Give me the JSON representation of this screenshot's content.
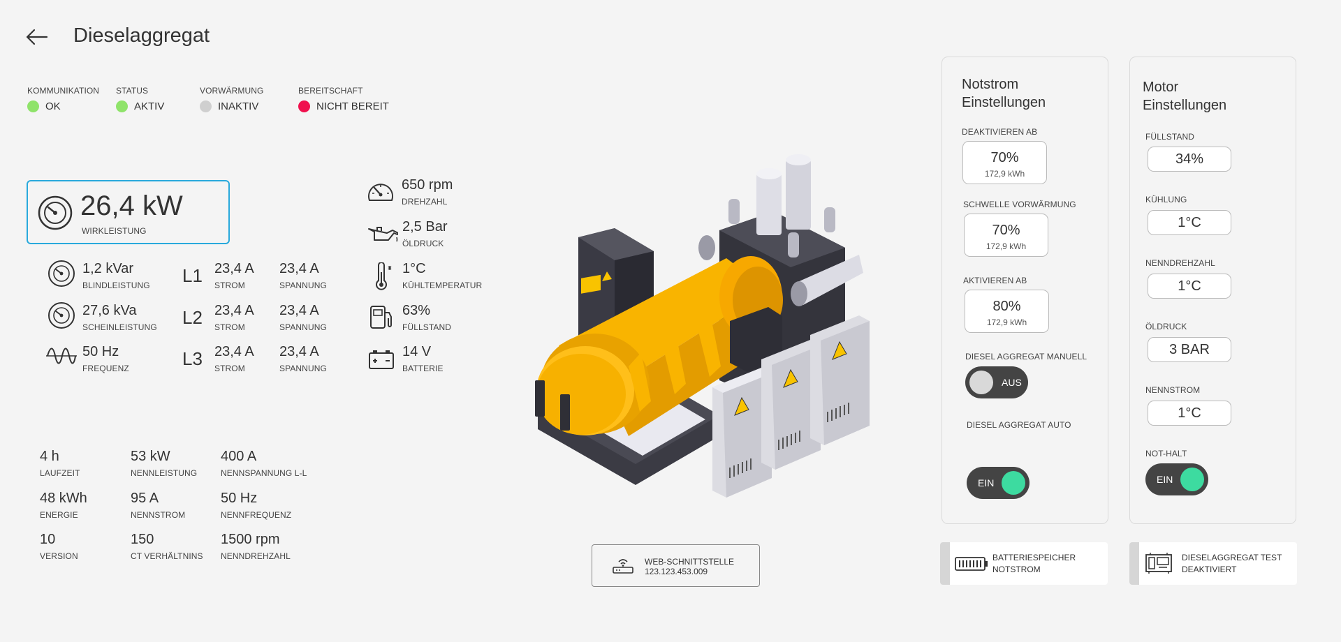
{
  "header": {
    "title": "Dieselaggregat"
  },
  "status": [
    {
      "label": "KOMMUNIKATION",
      "value": "OK",
      "color": "#8fe36a"
    },
    {
      "label": "STATUS",
      "value": "AKTIV",
      "color": "#8fe36a"
    },
    {
      "label": "VORWÄRMUNG",
      "value": "INAKTIV",
      "color": "#cfcfcf"
    },
    {
      "label": "BEREITSCHAFT",
      "value": "NICHT BEREIT",
      "color": "#f0114e"
    }
  ],
  "main_power": {
    "value": "26,4 kW",
    "label": "WIRKLEISTUNG",
    "icon": "gauge-icon",
    "accent": "#29a9dc"
  },
  "power_list": [
    {
      "value": "1,2 kVar",
      "label": "BLINDLEISTUNG"
    },
    {
      "value": "27,6 kVa",
      "label": "SCHEINLEISTUNG"
    },
    {
      "value": "50 Hz",
      "label": "FREQUENZ"
    }
  ],
  "phases": [
    {
      "name": "L1",
      "strom": "23,4 A",
      "strom_label": "STROM",
      "spannung": "23,4 A",
      "spannung_label": "SPANNUNG"
    },
    {
      "name": "L2",
      "strom": "23,4 A",
      "strom_label": "STROM",
      "spannung": "23,4 A",
      "spannung_label": "SPANNUNG"
    },
    {
      "name": "L3",
      "strom": "23,4 A",
      "strom_label": "STROM",
      "spannung": "23,4 A",
      "spannung_label": "SPANNUNG"
    }
  ],
  "engine_stats": [
    {
      "value": "650 rpm",
      "label": "DREHZAHL",
      "icon": "speedometer-icon"
    },
    {
      "value": "2,5 Bar",
      "label": "ÖLDRUCK",
      "icon": "oil-can-icon"
    },
    {
      "value": "1°C",
      "label": "KÜHLTEMPERATUR",
      "icon": "thermometer-icon"
    },
    {
      "value": "63%",
      "label": "FÜLLSTAND",
      "icon": "fuel-pump-icon"
    },
    {
      "value": "14 V",
      "label": "BATTERIE",
      "icon": "battery-icon"
    }
  ],
  "specs": [
    {
      "value": "4 h",
      "label": "LAUFZEIT"
    },
    {
      "value": "53 kW",
      "label": "NENNLEISTUNG"
    },
    {
      "value": "400 A",
      "label": "NENNSPANNUNG L-L"
    },
    {
      "value": "48 kWh",
      "label": "ENERGIE"
    },
    {
      "value": "95 A",
      "label": "NENNSTROM"
    },
    {
      "value": "50 Hz",
      "label": "NENNFREQUENZ"
    },
    {
      "value": "10",
      "label": "VERSION"
    },
    {
      "value": "150",
      "label": "CT VERHÄLTNINS"
    },
    {
      "value": "1500 rpm",
      "label": "NENNDREHZAHL"
    }
  ],
  "web_interface": {
    "label": "WEB-SCHNITTSTELLE",
    "address": "123.123.453.009"
  },
  "notstrom": {
    "title_line1": "Notstrom",
    "title_line2": "Einstellungen",
    "fields": [
      {
        "label": "DEAKTIVIEREN AB",
        "value": "70%",
        "sub": "172,9 kWh"
      },
      {
        "label": "SCHWELLE VORWÄRMUNG",
        "value": "70%",
        "sub": "172,9 kWh"
      },
      {
        "label": "AKTIVIEREN AB",
        "value": "80%",
        "sub": "172,9 kWh"
      }
    ],
    "manual": {
      "label": "DIESEL AGGREGAT MANUELL",
      "state": "AUS"
    },
    "auto": {
      "label": "DIESEL AGGREGAT AUTO",
      "state": "EIN"
    }
  },
  "motor": {
    "title_line1": "Motor",
    "title_line2": "Einstellungen",
    "fields": [
      {
        "label": "FÜLLSTAND",
        "value": "34%"
      },
      {
        "label": "KÜHLUNG",
        "value": "1°C"
      },
      {
        "label": "NENNDREHZAHL",
        "value": "1°C"
      },
      {
        "label": "ÖLDRUCK",
        "value": "3 BAR"
      },
      {
        "label": "NENNSTROM",
        "value": "1°C"
      }
    ],
    "nothalt": {
      "label": "NOT-HALT",
      "state": "EIN"
    }
  },
  "bottom_cards": [
    {
      "line1": "BATTERIESPEICHER",
      "line2": "NOTSTROM",
      "icon": "battery-storage-icon"
    },
    {
      "line1": "DIESELAGGREGAT TEST",
      "line2": "DEAKTIVIERT",
      "icon": "generator-icon"
    }
  ],
  "colors": {
    "on_knob": "#3ddba0",
    "off_knob": "#d9d9d9",
    "toggle_bg": "#444444",
    "generator_yellow": "#f9b400"
  }
}
